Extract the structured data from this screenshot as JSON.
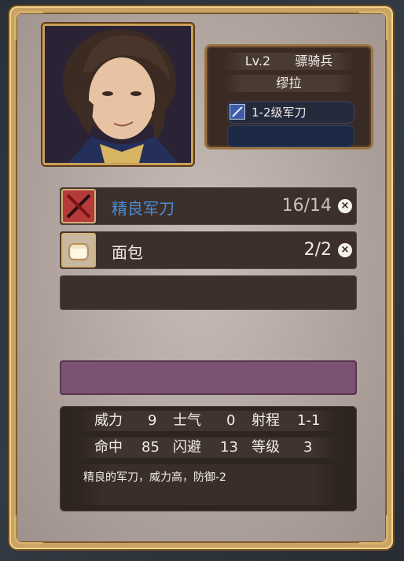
{
  "unit": {
    "level": "Lv.2",
    "class": "骠骑兵",
    "name": "缪拉",
    "equipped_weapon": "1-2级军刀"
  },
  "inventory": [
    {
      "name": "精良军刀",
      "count": "16/14",
      "highlighted": true,
      "icon": "saber-icon"
    },
    {
      "name": "面包",
      "count": "2/2",
      "highlighted": false,
      "icon": "bread-icon"
    }
  ],
  "stats": {
    "row1": [
      {
        "label": "威力",
        "value": "9"
      },
      {
        "label": "士气",
        "value": "0"
      },
      {
        "label": "射程",
        "value": "1-1"
      }
    ],
    "row2": [
      {
        "label": "命中",
        "value": "85"
      },
      {
        "label": "闪避",
        "value": "13"
      },
      {
        "label": "等级",
        "value": "3"
      }
    ],
    "description": "精良的军刀，威力高，防御-2"
  },
  "colors": {
    "frame_gold": "#caa263",
    "panel_bg": "#b9aca6",
    "highlight_blue": "#4a8bd6",
    "purple_slot": "#7a5372"
  }
}
